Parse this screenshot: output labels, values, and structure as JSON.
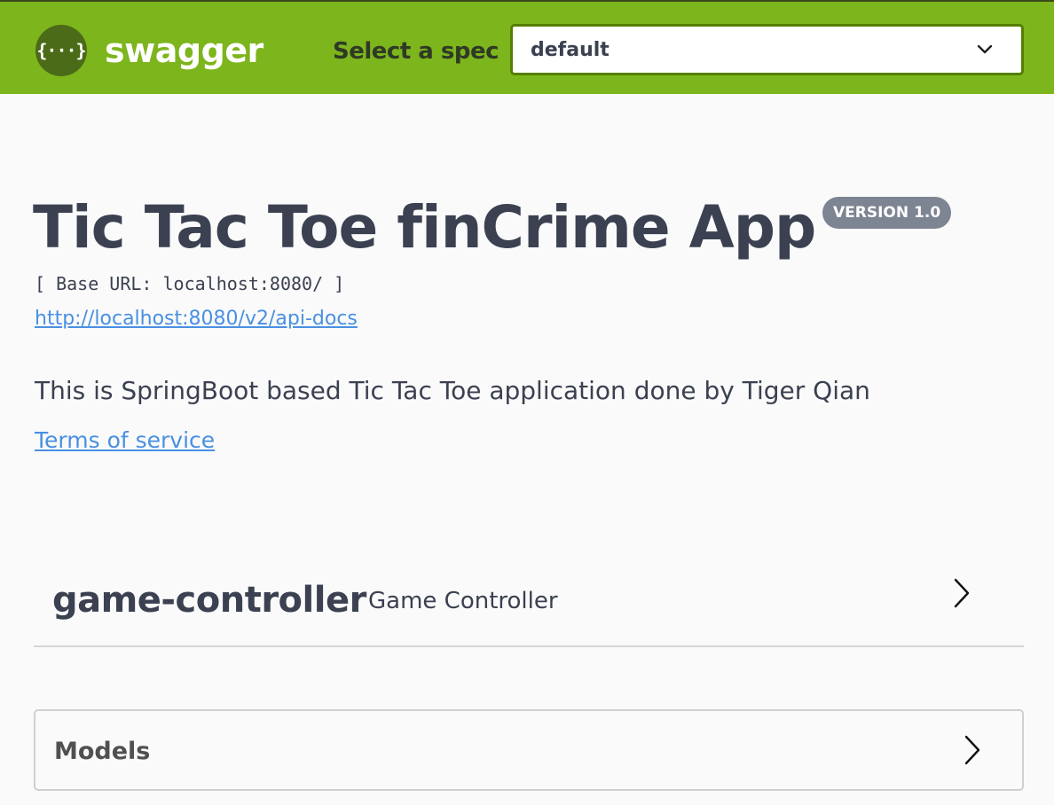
{
  "topbar": {
    "logo_glyph": "{···}",
    "brand": "swagger",
    "spec_label": "Select a spec",
    "spec_selected": "default",
    "colors": {
      "background": "#7db51d",
      "select_border": "#547f00"
    }
  },
  "info": {
    "title": "Tic Tac Toe finCrime App",
    "version_badge": "VERSION 1.0",
    "base_url": "[ Base URL: localhost:8080/ ]",
    "api_docs_link": "http://localhost:8080/v2/api-docs",
    "description": "This is SpringBoot based Tic Tac Toe application done by Tiger Qian",
    "terms_link": "Terms of service"
  },
  "tags": [
    {
      "name": "game-controller",
      "description": "Game Controller",
      "icon": "chevron-right-icon"
    }
  ],
  "models": {
    "label": "Models",
    "icon": "chevron-right-icon"
  }
}
